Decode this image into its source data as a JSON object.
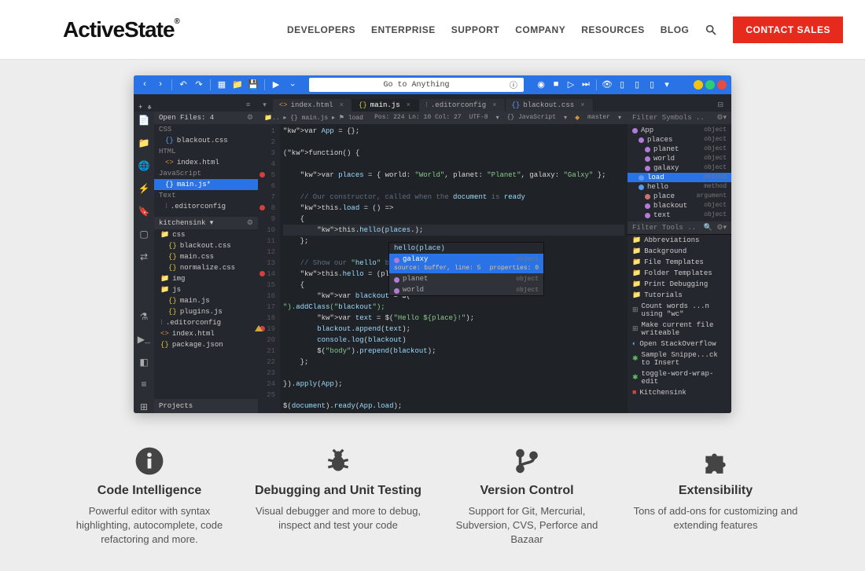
{
  "header": {
    "logo": "ActiveState",
    "nav": [
      "DEVELOPERS",
      "ENTERPRISE",
      "SUPPORT",
      "COMPANY",
      "RESOURCES",
      "BLOG"
    ],
    "contact": "CONTACT SALES"
  },
  "editor": {
    "goto_placeholder": "Go to Anything",
    "tabs": [
      {
        "icon": "<>",
        "label": "index.html"
      },
      {
        "icon": "{}",
        "label": "main.js",
        "active": true
      },
      {
        "icon": "⁝",
        "label": ".editorconfig"
      },
      {
        "icon": "{}",
        "label": "blackout.css"
      }
    ],
    "status": {
      "left": "Open Files: 4",
      "pos": "Pos: 224  Ln: 10 Col: 27",
      "enc": "UTF-8",
      "lang": "{} JavaScript",
      "branch": "master"
    },
    "sidebar": {
      "open_header": "Open Files: 4",
      "groups": [
        {
          "label": "CSS",
          "items": [
            {
              "i": "{}",
              "n": "blackout.css"
            }
          ]
        },
        {
          "label": "HTML",
          "items": [
            {
              "i": "<>",
              "n": "index.html"
            }
          ]
        },
        {
          "label": "JavaScript",
          "items": [
            {
              "i": "{}",
              "n": "main.js*",
              "sel": true
            }
          ]
        },
        {
          "label": "Text",
          "items": [
            {
              "i": "⁝",
              "n": ".editorconfig"
            }
          ]
        }
      ],
      "project": "kitchensink ▾",
      "tree": [
        {
          "i": "▸",
          "n": "css",
          "folder": true
        },
        {
          "i": "{}",
          "n": "blackout.css",
          "indent": 1
        },
        {
          "i": "{}",
          "n": "main.css",
          "indent": 1
        },
        {
          "i": "{}",
          "n": "normalize.css",
          "indent": 1
        },
        {
          "i": "▸",
          "n": "img",
          "folder": true
        },
        {
          "i": "▸",
          "n": "js",
          "folder": true
        },
        {
          "i": "{}",
          "n": "main.js",
          "indent": 1
        },
        {
          "i": "{}",
          "n": "plugins.js",
          "indent": 1
        },
        {
          "i": "⁝",
          "n": ".editorconfig"
        },
        {
          "i": "<>",
          "n": "index.html"
        },
        {
          "i": "{}",
          "n": "package.json"
        }
      ],
      "footer": "Projects"
    },
    "symbols": {
      "filter_placeholder": "Filter Symbols ..",
      "items": [
        {
          "c": "#b37bd6",
          "n": "App",
          "t": "object"
        },
        {
          "c": "#b37bd6",
          "n": "places",
          "t": "object",
          "ind": 1
        },
        {
          "c": "#b37bd6",
          "n": "planet",
          "t": "object",
          "ind": 2
        },
        {
          "c": "#b37bd6",
          "n": "world",
          "t": "object",
          "ind": 2
        },
        {
          "c": "#b37bd6",
          "n": "galaxy",
          "t": "object",
          "ind": 2
        },
        {
          "c": "#5a9bed",
          "n": "load",
          "t": "method",
          "ind": 1,
          "sel": true
        },
        {
          "c": "#5a9bed",
          "n": "hello",
          "t": "method",
          "ind": 1
        },
        {
          "c": "#d36e6e",
          "n": "place",
          "t": "argument",
          "ind": 2
        },
        {
          "c": "#b37bd6",
          "n": "blackout",
          "t": "object",
          "ind": 2
        },
        {
          "c": "#b37bd6",
          "n": "text",
          "t": "object",
          "ind": 2
        }
      ],
      "tools_filter": "Filter Tools ..",
      "tools": [
        "Abbreviations",
        "Background",
        "File Templates",
        "Folder Templates",
        "Print Debugging",
        "Tutorials"
      ],
      "macros": [
        {
          "i": "⊞",
          "n": "Count words ...n using \"wc\""
        },
        {
          "i": "⊞",
          "n": "Make current file writeable"
        },
        {
          "i": "◐",
          "n": "Open StackOverflow"
        },
        {
          "i": "✱",
          "n": "Sample Snippe...ck to Insert"
        },
        {
          "i": "✱",
          "n": "toggle-word-wrap-edit"
        },
        {
          "i": "■",
          "n": "Kitchensink"
        }
      ]
    },
    "code_lines": [
      "var App = {};",
      "",
      "(function() {",
      "",
      "    var places = { world: \"World\", planet: \"Planet\", galaxy: \"Galxy\" };",
      "",
      "    // Our constructor, called when the document is ready",
      "    this.load = () =>",
      "    {",
      "        this.hello(places.);",
      "    };",
      "",
      "    // Show our \"hello\" bl…",
      "    this.hello = (place =",
      "    {",
      "        var blackout = $(\"<div>\").addClass(\"blackout\");",
      "        var text = $(\"<span>Hello ${place}!</span>\");",
      "        blackout.append(text);",
      "        console.log(blackout)",
      "        $(\"body\").prepend(blackout);",
      "    };",
      "",
      "}).apply(App);",
      "",
      "$(document).ready(App.load);"
    ],
    "autocomplete": {
      "sig": "hello(place)",
      "rows": [
        {
          "c": "#b37bd6",
          "n": "galaxy",
          "t": "object",
          "sel": true,
          "sub": "source: buffer, line: 5",
          "props": "properties: 0"
        },
        {
          "c": "#b37bd6",
          "n": "planet",
          "t": "object"
        },
        {
          "c": "#b37bd6",
          "n": "world",
          "t": "object"
        }
      ]
    }
  },
  "features": [
    {
      "icon": "info",
      "title": "Code Intelligence",
      "desc": "Powerful editor with syntax highlighting, autocomplete, code refactoring and more."
    },
    {
      "icon": "bug",
      "title": "Debugging and Unit Testing",
      "desc": "Visual debugger and more to debug, inspect and test your code"
    },
    {
      "icon": "branch",
      "title": "Version Control",
      "desc": "Support for Git, Mercurial, Subversion, CVS, Perforce and Bazaar"
    },
    {
      "icon": "puzzle",
      "title": "Extensibility",
      "desc": "Tons of add-ons for customizing and extending features"
    }
  ]
}
